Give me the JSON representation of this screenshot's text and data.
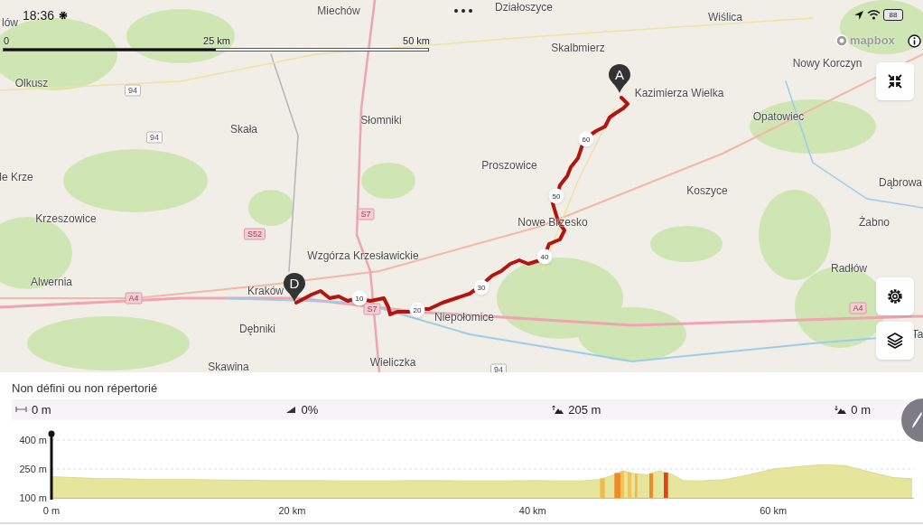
{
  "status_bar": {
    "time": "18:36",
    "battery": "88"
  },
  "scale_bar": {
    "labels": [
      "0",
      "25 km",
      "50 km"
    ]
  },
  "attribution": {
    "logo": "mapbox"
  },
  "map": {
    "places": [
      {
        "name": "lów"
      },
      {
        "name": "Miechów"
      },
      {
        "name": "Działoszyce"
      },
      {
        "name": "Wiślica"
      },
      {
        "name": "Skalbmierz"
      },
      {
        "name": "Nowy Korczyn"
      },
      {
        "name": "Olkusz"
      },
      {
        "name": "Kazimierza Wielka"
      },
      {
        "name": "Opatowiec"
      },
      {
        "name": "Słomniki"
      },
      {
        "name": "Skała"
      },
      {
        "name": "Proszowice"
      },
      {
        "name": "le Krze"
      },
      {
        "name": "Dąbrowa"
      },
      {
        "name": "Koszyce"
      },
      {
        "name": "Krzeszowice"
      },
      {
        "name": "Nowe Brzesko"
      },
      {
        "name": "Żabno"
      },
      {
        "name": "Wzgórza Krzesławickie"
      },
      {
        "name": "Radłów"
      },
      {
        "name": "Alwernia"
      },
      {
        "name": "Kraków"
      },
      {
        "name": "Niepołomice"
      },
      {
        "name": "Dębniki"
      },
      {
        "name": "Ta"
      },
      {
        "name": "Wieliczka"
      },
      {
        "name": "Skawina"
      }
    ],
    "road_shields": [
      {
        "label": "94",
        "kind": "national"
      },
      {
        "label": "94",
        "kind": "national"
      },
      {
        "label": "S7",
        "kind": "expressway"
      },
      {
        "label": "S52",
        "kind": "expressway"
      },
      {
        "label": "A4",
        "kind": "expressway"
      },
      {
        "label": "S7",
        "kind": "expressway"
      },
      {
        "label": "94",
        "kind": "national"
      },
      {
        "label": "A4",
        "kind": "expressway"
      }
    ],
    "route_markers": [
      "10",
      "20",
      "30",
      "40",
      "50",
      "60"
    ],
    "pins": [
      {
        "label": "A"
      },
      {
        "label": "D"
      }
    ]
  },
  "map_buttons": [
    {
      "kind": "collapse"
    },
    {
      "kind": "settings"
    },
    {
      "kind": "layers"
    }
  ],
  "elevation_panel": {
    "title": "Non défini ou non répertorié",
    "stats": [
      {
        "kind": "distance",
        "value": "0 m"
      },
      {
        "kind": "grade",
        "value": "0%"
      },
      {
        "kind": "ascent",
        "value": "205 m"
      },
      {
        "kind": "descent",
        "value": "0 m"
      }
    ],
    "chart_data": {
      "type": "area",
      "x": [
        0,
        2,
        4,
        6,
        8,
        10,
        12,
        14,
        16,
        18,
        20,
        22,
        24,
        26,
        28,
        30,
        32,
        34,
        36,
        38,
        40,
        42,
        44,
        45.5,
        46.5,
        47.5,
        48.5,
        49.5,
        50.5,
        51.5,
        52.5,
        54,
        56,
        58,
        60,
        62,
        64,
        66,
        68,
        70,
        71.5
      ],
      "series": [
        {
          "color": "#e6e59c",
          "values": [
            210,
            205,
            200,
            200,
            195,
            195,
            195,
            193,
            192,
            190,
            190,
            190,
            188,
            188,
            188,
            190,
            190,
            188,
            188,
            188,
            190,
            188,
            188,
            195,
            215,
            240,
            225,
            220,
            240,
            225,
            190,
            188,
            195,
            220,
            250,
            262,
            272,
            268,
            235,
            205,
            200
          ]
        }
      ],
      "xlim": [
        0,
        71.7
      ],
      "ylim": [
        100,
        400
      ],
      "xticks": [
        {
          "value": 0,
          "label": "0 m"
        },
        {
          "value": 20,
          "label": "20 km"
        },
        {
          "value": 40,
          "label": "40 km"
        },
        {
          "value": 60,
          "label": "60 km"
        }
      ],
      "yticks": [
        {
          "value": 100,
          "label": "100 m"
        },
        {
          "value": 250,
          "label": "250 m"
        },
        {
          "value": 400,
          "label": "400 m"
        }
      ]
    }
  }
}
